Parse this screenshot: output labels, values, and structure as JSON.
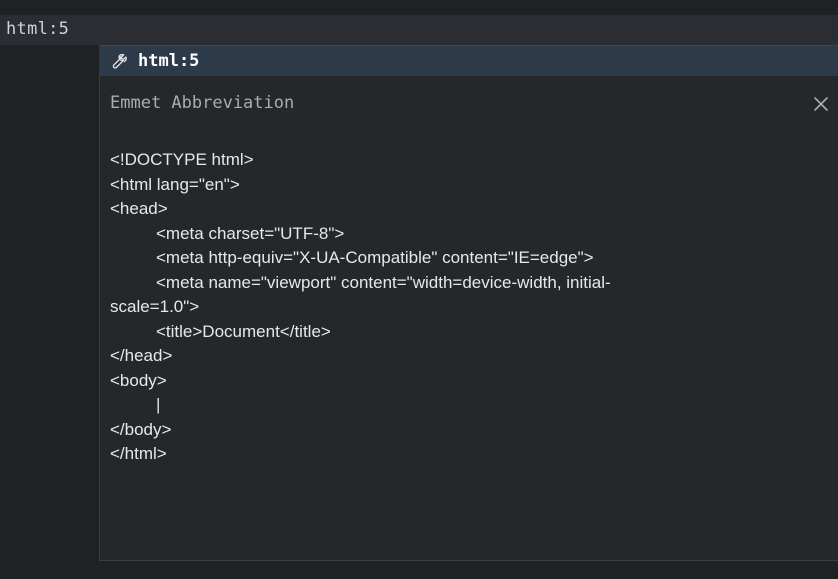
{
  "editor": {
    "typed_text": "html:5"
  },
  "suggestion": {
    "icon": "wrench-icon",
    "label": "html:5"
  },
  "details": {
    "title": "Emmet Abbreviation",
    "close_icon": "close-icon",
    "code_lines": [
      "<!DOCTYPE html>",
      "<html lang=\"en\">",
      "<head>",
      "<meta charset=\"UTF-8\">",
      "<meta http-equiv=\"X-UA-Compatible\" content=\"IE=edge\">",
      "<meta name=\"viewport\" content=\"width=device-width, initial-",
      "scale=1.0\">",
      "<title>Document</title>",
      "</head>",
      "<body>",
      "|",
      "</body>",
      "</html>"
    ]
  },
  "colors": {
    "background": "#1f2124",
    "current_line": "#2a2d31",
    "suggestion_highlight": "#2c3a4a",
    "details_background": "#25272b",
    "text": "#e6e8eb",
    "muted_text": "#a8adb3"
  }
}
